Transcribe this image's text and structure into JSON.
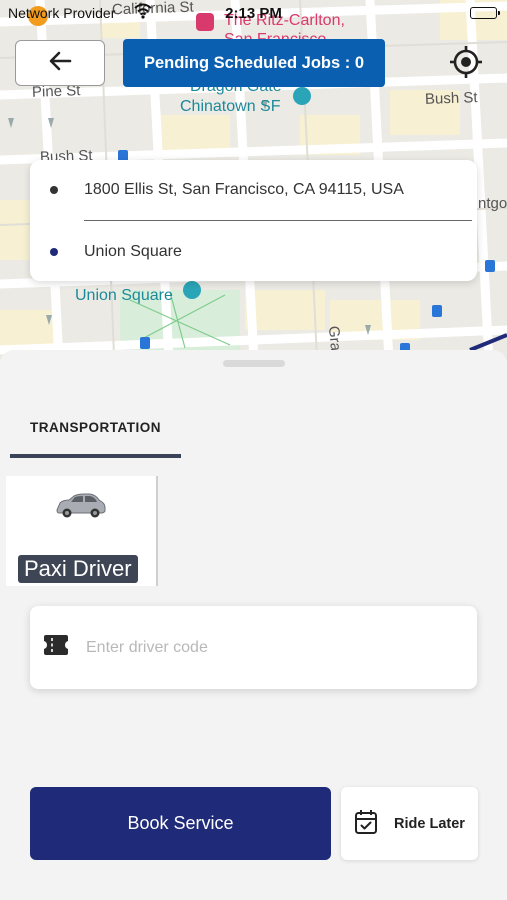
{
  "status_bar": {
    "carrier": "Network Provider",
    "time": "2:13 PM"
  },
  "map": {
    "labels": {
      "california": "California St",
      "pine": "Pine St",
      "bush_left": "Bush St",
      "bush_right": "Bush St",
      "ritz": "The Ritz-Carlton,",
      "ritz2": "San Francisco",
      "dragon": "Dragon Gate",
      "chinatown": "Chinatown SF",
      "union": "Union Square",
      "grant": "Gra",
      "montgomery": "ntgo"
    }
  },
  "header": {
    "pending_jobs_label": "Pending Scheduled Jobs : 0"
  },
  "addresses": {
    "pickup": "1800 Ellis St, San Francisco, CA 94115, USA",
    "dropoff": "Union Square",
    "pickup_dot_color": "#333333",
    "dropoff_dot_color": "#1f2a78"
  },
  "sheet": {
    "tab_label": "TRANSPORTATION",
    "vehicle_name": "Paxi Driver",
    "code_placeholder": "Enter driver code",
    "book_label": "Book Service",
    "later_label": "Ride Later"
  },
  "colors": {
    "primary": "#1f2a78",
    "pending_bg": "#0b5fb0"
  },
  "icons": {
    "back": "arrow-left-icon",
    "locate": "crosshair-icon",
    "ticket": "ticket-icon",
    "calendar": "calendar-check-icon",
    "car": "car-icon"
  }
}
